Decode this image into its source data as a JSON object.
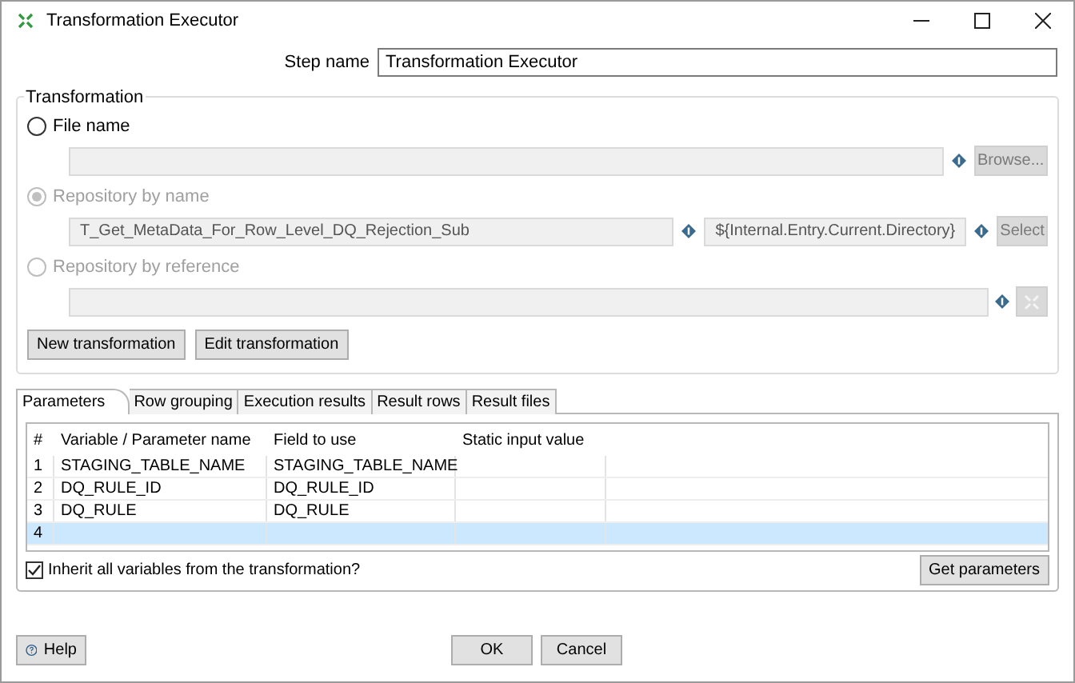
{
  "window": {
    "title": "Transformation Executor"
  },
  "step_name": {
    "label": "Step name",
    "value": "Transformation Executor"
  },
  "transformation": {
    "title": "Transformation",
    "options": [
      {
        "label": "File name",
        "selected": false,
        "disabled": false,
        "kind": "file",
        "button": "Browse..."
      },
      {
        "label": "Repository by name",
        "selected": true,
        "disabled": true,
        "kind": "name",
        "value": "T_Get_MetaData_For_Row_Level_DQ_Rejection_Sub",
        "directory": "${Internal.Entry.Current.Directory}",
        "button": "Select"
      },
      {
        "label": "Repository by reference",
        "selected": false,
        "disabled": true,
        "kind": "reference"
      }
    ],
    "buttons": [
      "New transformation",
      "Edit transformation"
    ]
  },
  "tabs": [
    {
      "label": "Parameters",
      "selected": true
    },
    {
      "label": "Row grouping",
      "selected": false
    },
    {
      "label": "Execution results",
      "selected": false
    },
    {
      "label": "Result rows",
      "selected": false
    },
    {
      "label": "Result files",
      "selected": false
    }
  ],
  "table": {
    "columns": [
      "#",
      "Variable / Parameter name",
      "Field to use",
      "Static input value"
    ],
    "rows": [
      {
        "cells": [
          "1",
          "STAGING_TABLE_NAME",
          "STAGING_TABLE_NAME",
          ""
        ],
        "selected": false
      },
      {
        "cells": [
          "2",
          "DQ_RULE_ID",
          "DQ_RULE_ID",
          ""
        ],
        "selected": false
      },
      {
        "cells": [
          "3",
          "DQ_RULE",
          "DQ_RULE",
          ""
        ],
        "selected": false
      },
      {
        "cells": [
          "4",
          "",
          "",
          ""
        ],
        "selected": true
      }
    ]
  },
  "inherit": {
    "label": "Inherit all variables from the transformation?",
    "checked": true
  },
  "get_parameters": "Get parameters",
  "footer": {
    "help": "Help",
    "ok": "OK",
    "cancel": "Cancel"
  }
}
